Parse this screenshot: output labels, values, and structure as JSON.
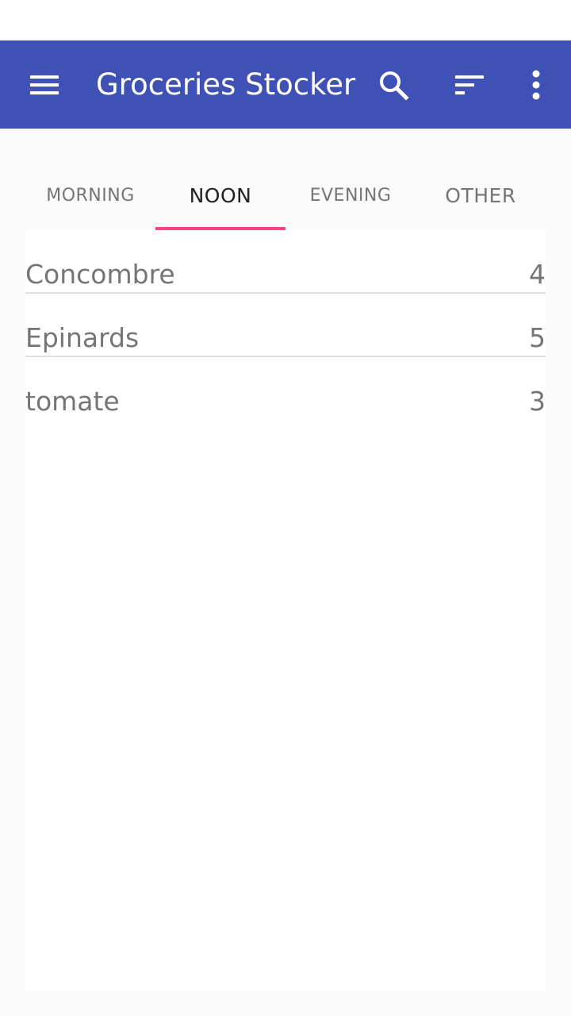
{
  "app_bar": {
    "title": "Groceries Stocker",
    "background": "#3f51b5",
    "icons": [
      "menu-icon",
      "search-icon",
      "sort-icon",
      "more-vert-icon"
    ]
  },
  "tabs": [
    {
      "label": "MORNING",
      "active": false
    },
    {
      "label": "NOON",
      "active": true
    },
    {
      "label": "EVENING",
      "active": false
    },
    {
      "label": "OTHER",
      "active": false
    }
  ],
  "accent_color": "#ff4081",
  "items": [
    {
      "name": "Concombre",
      "quantity": "4"
    },
    {
      "name": "Epinards",
      "quantity": "5"
    },
    {
      "name": "tomate",
      "quantity": "3"
    }
  ]
}
